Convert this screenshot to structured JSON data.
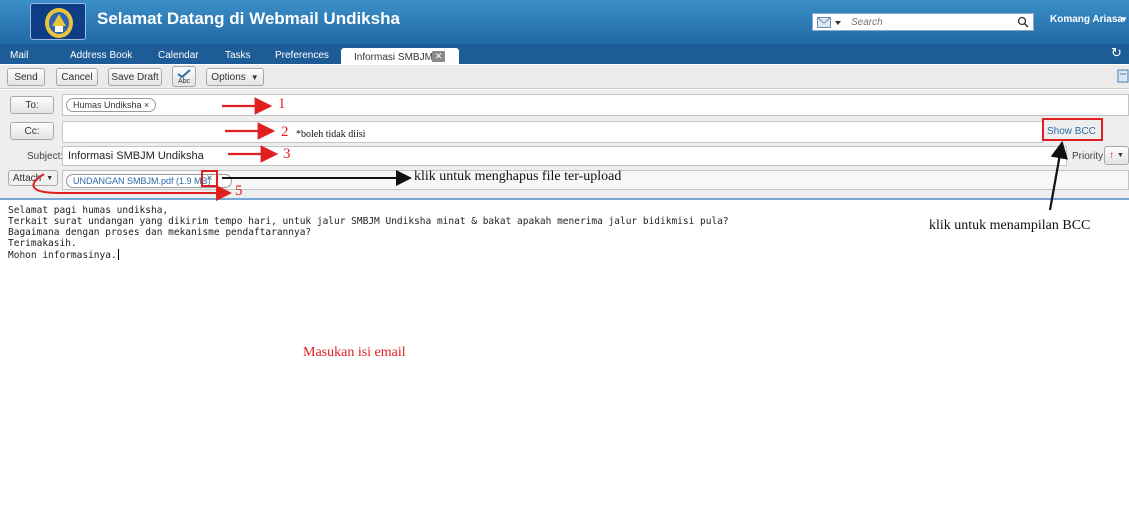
{
  "header": {
    "title": "Selamat Datang di Webmail Undiksha",
    "search_placeholder": "Search",
    "user_name": "Komang Ariasa",
    "colors": {
      "header": "#2a78b8",
      "tabbar": "#1d5c96",
      "accent": "#7aa6d6"
    }
  },
  "tabs": [
    {
      "label": "Mail"
    },
    {
      "label": "Address Book"
    },
    {
      "label": "Calendar"
    },
    {
      "label": "Tasks"
    },
    {
      "label": "Preferences"
    }
  ],
  "active_tab": {
    "label": "Informasi SMBJM",
    "close": "✕"
  },
  "toolbar": {
    "send": "Send",
    "cancel": "Cancel",
    "save_draft": "Save Draft",
    "spell": "Abc",
    "options": "Options"
  },
  "compose": {
    "to_button": "To:",
    "to_recipient": "Humas Undiksha ×",
    "cc_button": "Cc:",
    "show_bcc": "Show BCC",
    "subject_label": "Subject:",
    "subject_value": "Informasi SMBJM Undiksha",
    "priority_label": "Priority:",
    "attach_button": "Attach",
    "attachment": "UNDANGAN SMBJM.pdf (1.9 MB)",
    "attachment_remove": "×"
  },
  "body_lines": [
    "Selamat pagi humas undiksha,",
    "Terkait surat undangan yang dikirim tempo hari, untuk jalur SMBJM Undiksha minat & bakat apakah menerima jalur bidikmisi pula?",
    "Bagaimana dengan proses dan mekanisme pendaftarannya?",
    "Terimakasih.",
    "Mohon informasinya."
  ],
  "annotations": {
    "n1": "1",
    "n2": "2",
    "cc_note": "*boleh tidak diisi",
    "n3": "3",
    "remove_note": "klik untuk menghapus file ter-upload",
    "n5": "5",
    "bcc_note": "klik untuk menampilan BCC",
    "body_note": "Masukan isi email"
  }
}
